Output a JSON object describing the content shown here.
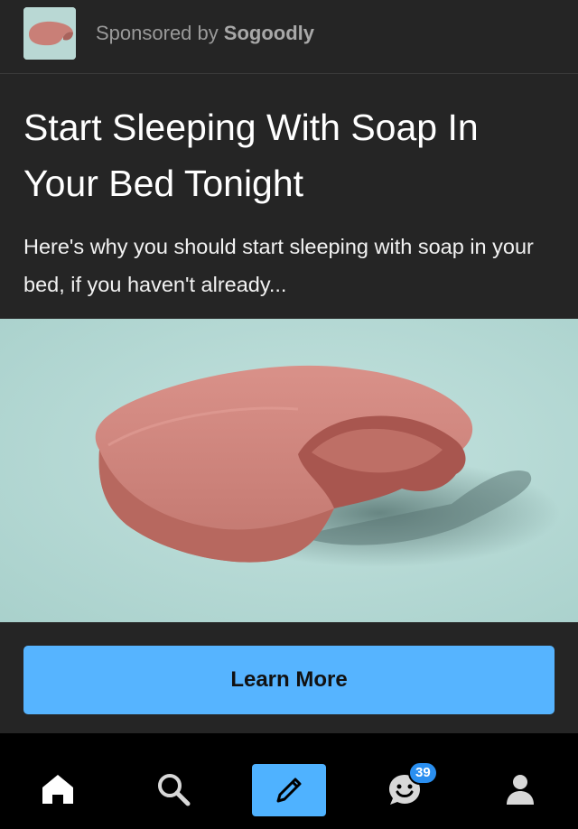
{
  "sponsor": {
    "prefix": "Sponsored by",
    "name": "Sogoodly",
    "thumbnail_icon": "soap-bar-thumbnail"
  },
  "ad": {
    "headline": "Start Sleeping With Soap In Your Bed Tonight",
    "description": "Here's why you should start sleeping with soap in your bed, if you haven't already...",
    "image": "pink-soap-bar-bitten",
    "cta_label": "Learn More"
  },
  "tabbar": {
    "items": [
      {
        "icon": "home-icon"
      },
      {
        "icon": "search-icon"
      },
      {
        "icon": "pencil-icon"
      },
      {
        "icon": "chat-smiley-icon"
      },
      {
        "icon": "person-icon"
      }
    ],
    "notification_count": "39"
  },
  "colors": {
    "card_background": "#252525",
    "accent": "#56b4ff",
    "badge": "#2a8ff0",
    "tabbar_background": "#000000"
  }
}
